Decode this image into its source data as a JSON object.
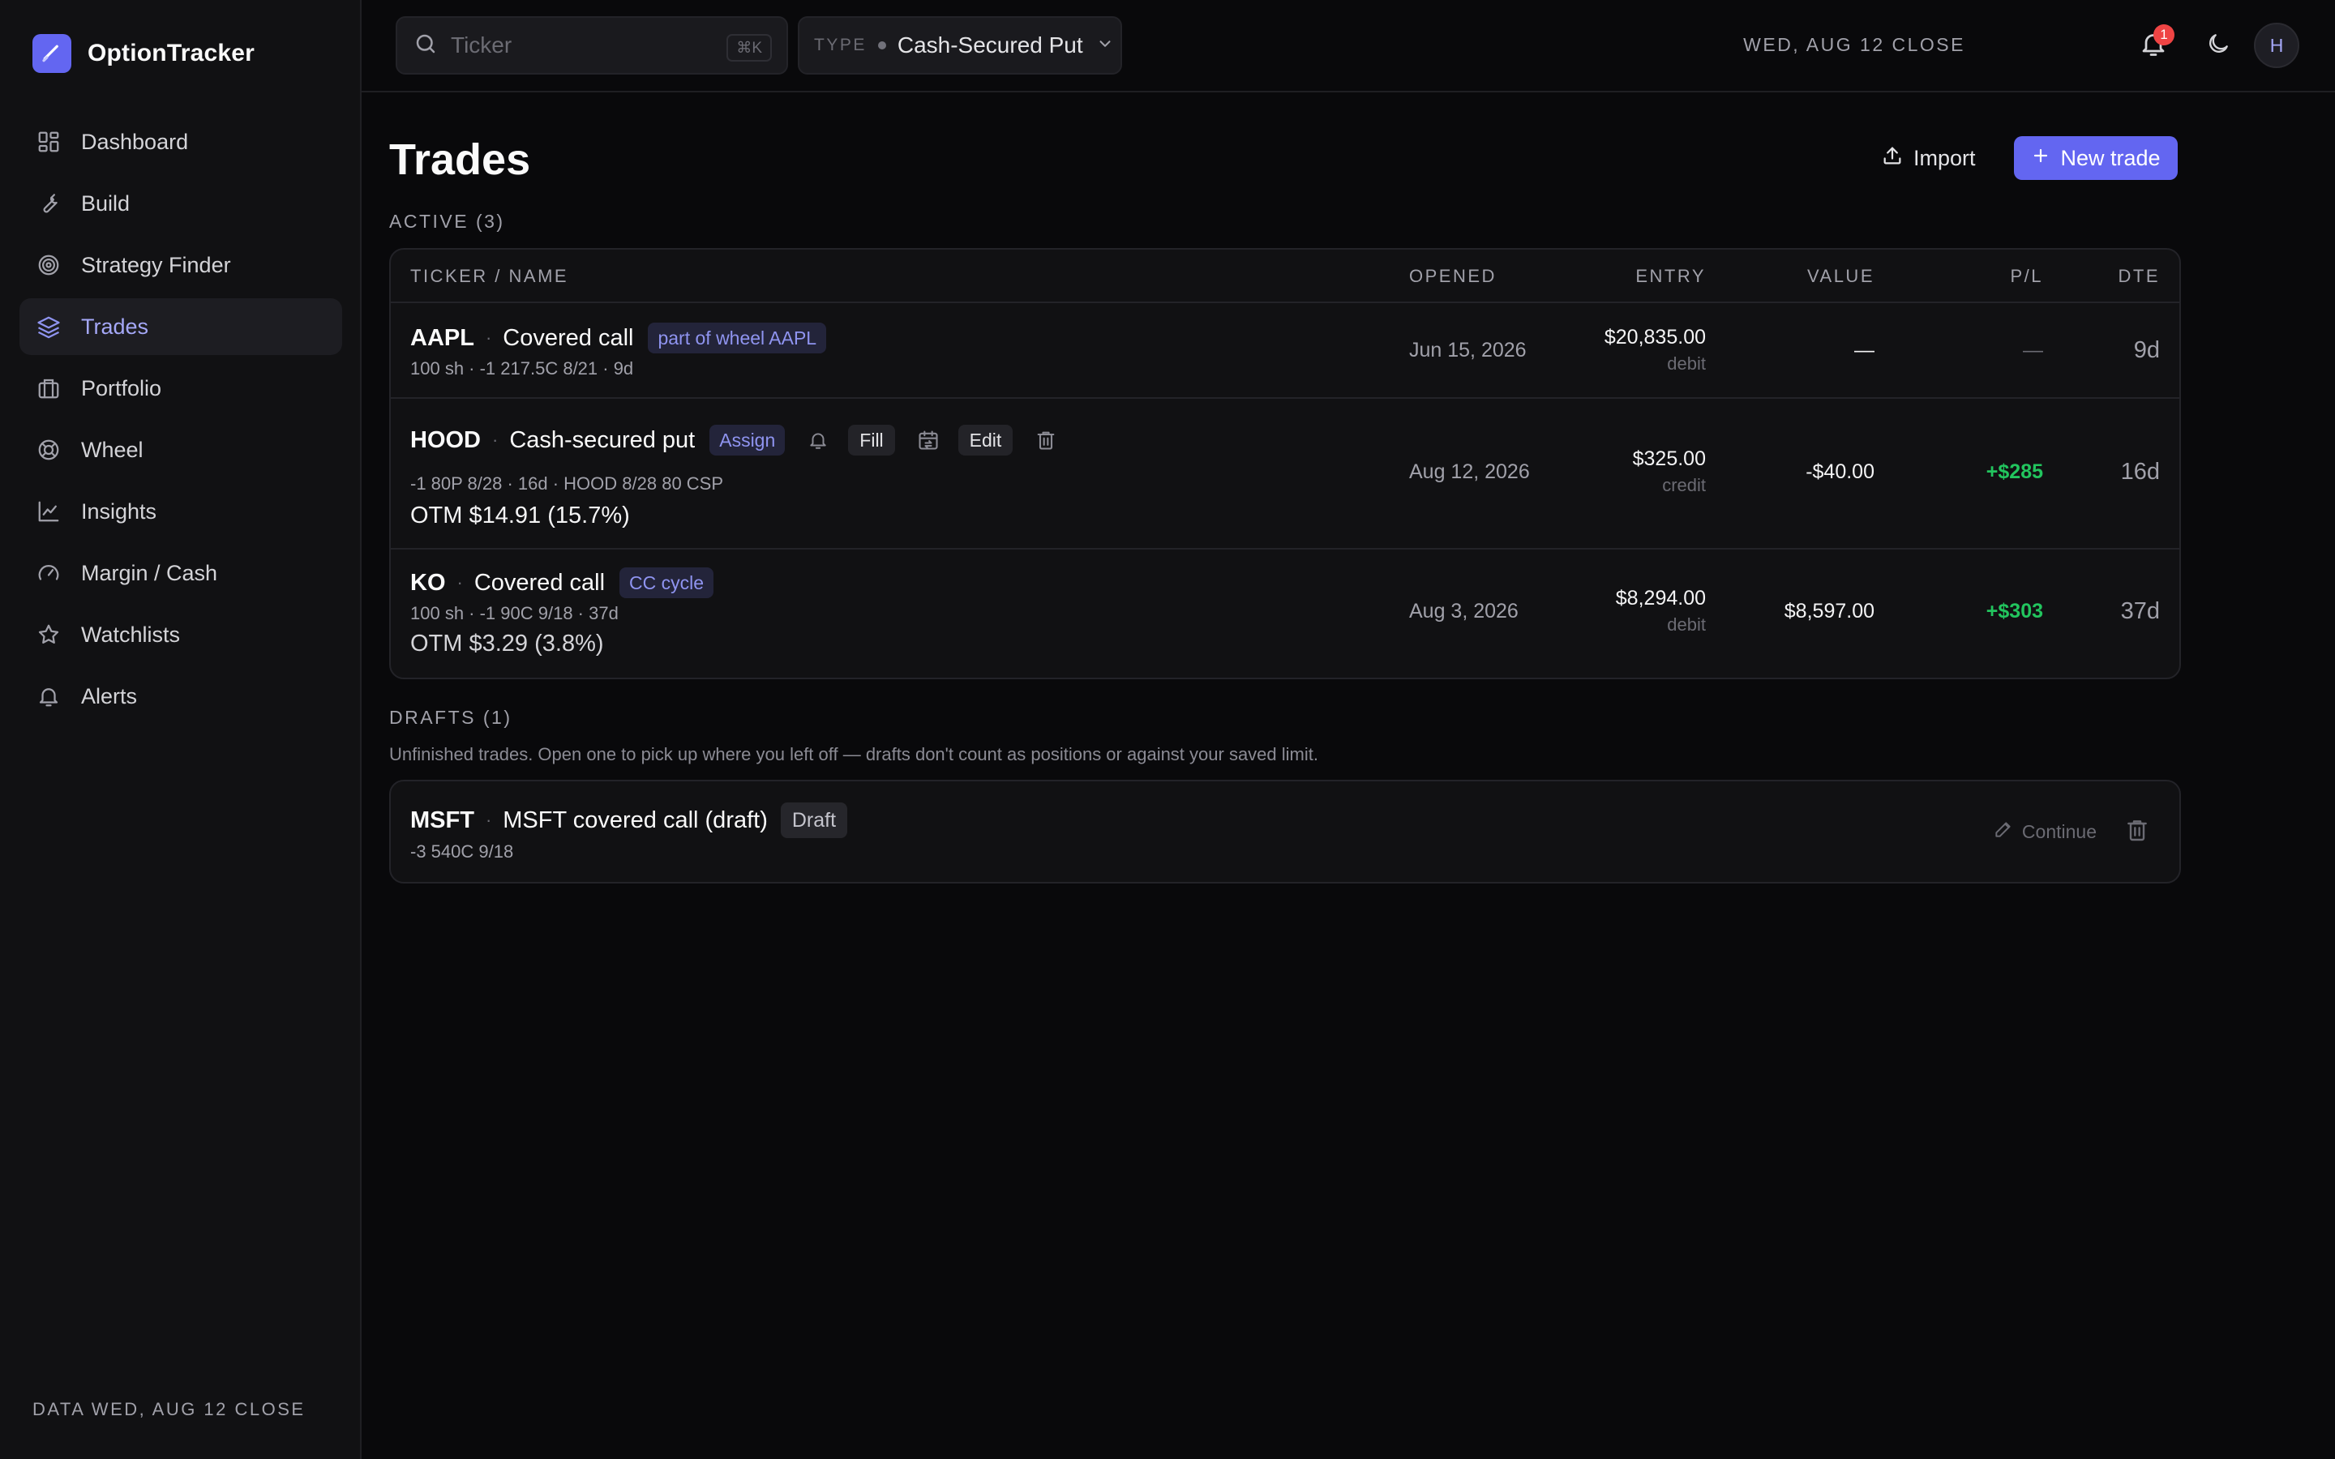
{
  "app": {
    "name": "OptionTracker"
  },
  "sidebar": {
    "items": [
      {
        "label": "Dashboard",
        "icon": "dashboard-icon"
      },
      {
        "label": "Build",
        "icon": "wrench-icon"
      },
      {
        "label": "Strategy Finder",
        "icon": "target-icon"
      },
      {
        "label": "Trades",
        "icon": "layers-icon",
        "active": true
      },
      {
        "label": "Portfolio",
        "icon": "briefcase-icon"
      },
      {
        "label": "Wheel",
        "icon": "lifebuoy-icon"
      },
      {
        "label": "Insights",
        "icon": "line-chart-icon"
      },
      {
        "label": "Margin / Cash",
        "icon": "gauge-icon"
      },
      {
        "label": "Watchlists",
        "icon": "star-icon"
      },
      {
        "label": "Alerts",
        "icon": "bell-icon"
      }
    ],
    "footer": "DATA WED, AUG 12 CLOSE"
  },
  "topbar": {
    "search_placeholder": "Ticker",
    "search_shortcut": "⌘K",
    "type_label": "TYPE",
    "type_value": "Cash-Secured Put",
    "closing": "WED, AUG 12 CLOSE",
    "notification_count": "1",
    "avatar_initial": "H"
  },
  "page": {
    "title": "Trades",
    "import_label": "Import",
    "new_trade_label": "New trade",
    "active_label": "ACTIVE (3)",
    "drafts_label": "DRAFTS (1)",
    "drafts_help": "Unfinished trades. Open one to pick up where you left off — drafts don't count as positions or against your saved limit."
  },
  "table": {
    "headers": {
      "ticker": "TICKER / NAME",
      "opened": "OPENED",
      "entry": "ENTRY",
      "value": "VALUE",
      "pl": "P/L",
      "dte": "DTE"
    },
    "rows": [
      {
        "ticker": "AAPL",
        "strategy": "Covered call",
        "tag": "part of wheel AAPL",
        "detail": "100 sh · -1 217.5C 8/21 · 9d",
        "otm": "",
        "opened": "Jun 15, 2026",
        "entry": "$20,835.00",
        "entry_type": "debit",
        "value": "—",
        "pl": "—",
        "dte": "9d"
      },
      {
        "ticker": "HOOD",
        "strategy": "Cash-secured put",
        "tag": "Assign",
        "actions": {
          "fill": "Fill",
          "edit": "Edit"
        },
        "detail": "-1 80P 8/28 · 16d · HOOD 8/28 80 CSP",
        "otm": "OTM $14.91 (15.7%)",
        "opened": "Aug 12, 2026",
        "entry": "$325.00",
        "entry_type": "credit",
        "value": "-$40.00",
        "pl": "+$285",
        "dte": "16d"
      },
      {
        "ticker": "KO",
        "strategy": "Covered call",
        "tag": "CC cycle",
        "detail": "100 sh · -1 90C 9/18 · 37d",
        "otm": "OTM $3.29 (3.8%)",
        "opened": "Aug 3, 2026",
        "entry": "$8,294.00",
        "entry_type": "debit",
        "value": "$8,597.00",
        "pl": "+$303",
        "dte": "37d"
      }
    ]
  },
  "drafts": [
    {
      "ticker": "MSFT",
      "name": "MSFT covered call (draft)",
      "tag": "Draft",
      "detail": "-3 540C 9/18",
      "continue_label": "Continue"
    }
  ],
  "colors": {
    "accent": "#6366f1",
    "positive": "#22c55e",
    "badge": "#ef4444",
    "background": "#09090b",
    "sidebar": "#111113"
  }
}
